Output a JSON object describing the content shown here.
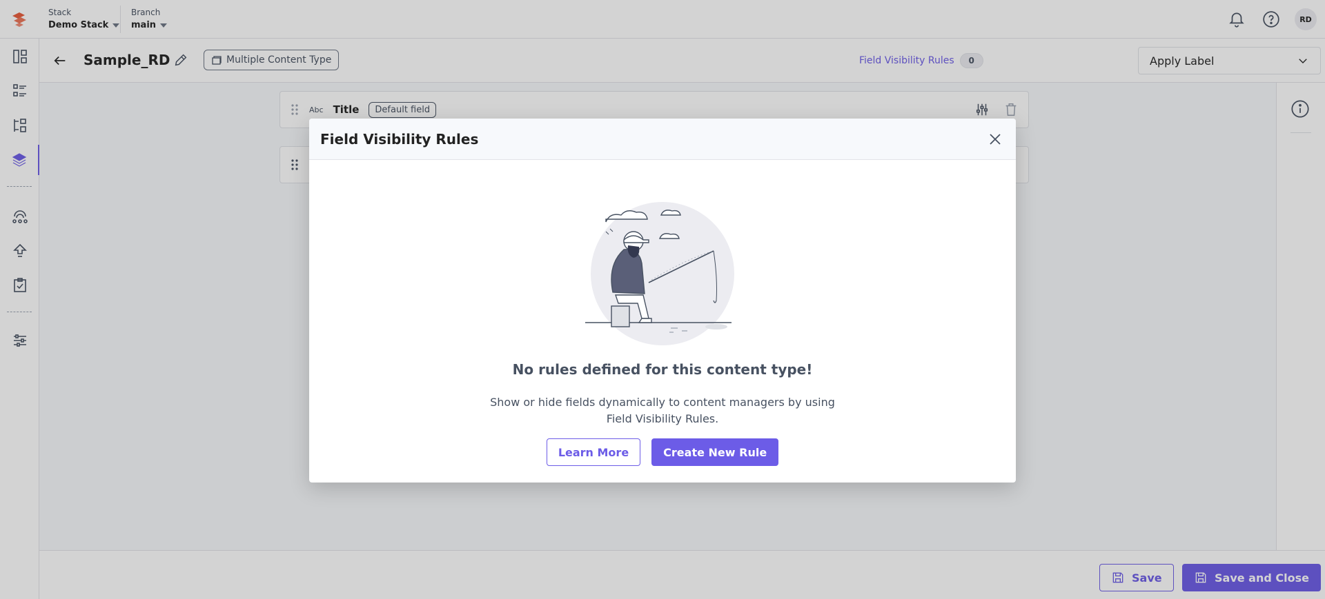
{
  "topbar": {
    "stack_label": "Stack",
    "stack_value": "Demo Stack",
    "branch_label": "Branch",
    "branch_value": "main",
    "user_initials": "RD"
  },
  "header": {
    "title": "Sample_RD",
    "content_type_chip": "Multiple Content Type",
    "fvr_link": "Field Visibility Rules",
    "fvr_count": "0",
    "apply_label": "Apply Label"
  },
  "fields": [
    {
      "type_badge": "Abc",
      "name": "Title",
      "chip": "Default field"
    }
  ],
  "footer": {
    "save_label": "Save",
    "save_close_label": "Save and Close"
  },
  "modal": {
    "title": "Field Visibility Rules",
    "empty_title": "No rules defined for this content type!",
    "empty_desc": "Show or hide fields dynamically to content managers by using Field Visibility Rules.",
    "learn_more": "Learn More",
    "create_rule": "Create New Rule"
  },
  "colors": {
    "accent": "#6c5ce7",
    "text_secondary": "#475161",
    "logo": "#e85a3a"
  }
}
